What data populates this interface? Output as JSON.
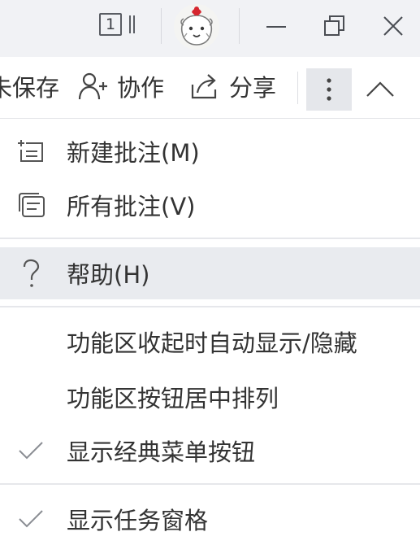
{
  "titlebar": {
    "doc_count": "1",
    "icons": {
      "doc_count": "document-count-icon",
      "avatar": "user-avatar",
      "minimize": "minimize-icon",
      "maximize": "restore-icon",
      "close": "close-icon"
    }
  },
  "toolbar": {
    "save_label": "未保存",
    "collab_label": "协作",
    "share_label": "分享",
    "icons": {
      "collab": "add-user-icon",
      "share": "share-icon",
      "more": "more-vertical-icon",
      "collapse": "chevron-up-icon"
    }
  },
  "menu": {
    "items": [
      {
        "label": "新建批注(M)",
        "icon": "new-comment-icon",
        "checked": false
      },
      {
        "label": "所有批注(V)",
        "icon": "all-comments-icon",
        "checked": false
      },
      {
        "label": "帮助(H)",
        "icon": "help-icon",
        "checked": false,
        "highlighted": true
      },
      {
        "label": "功能区收起时自动显示/隐藏",
        "icon": "",
        "checked": false
      },
      {
        "label": "功能区按钮居中排列",
        "icon": "",
        "checked": false
      },
      {
        "label": "显示经典菜单按钮",
        "icon": "check-icon",
        "checked": true
      },
      {
        "label": "显示任务窗格",
        "icon": "check-icon",
        "checked": true
      }
    ]
  },
  "colors": {
    "titlebar_bg": "#f1f2f5",
    "menu_hover_bg": "#e9ebef",
    "text": "#333333",
    "divider": "#e6e7eb"
  }
}
